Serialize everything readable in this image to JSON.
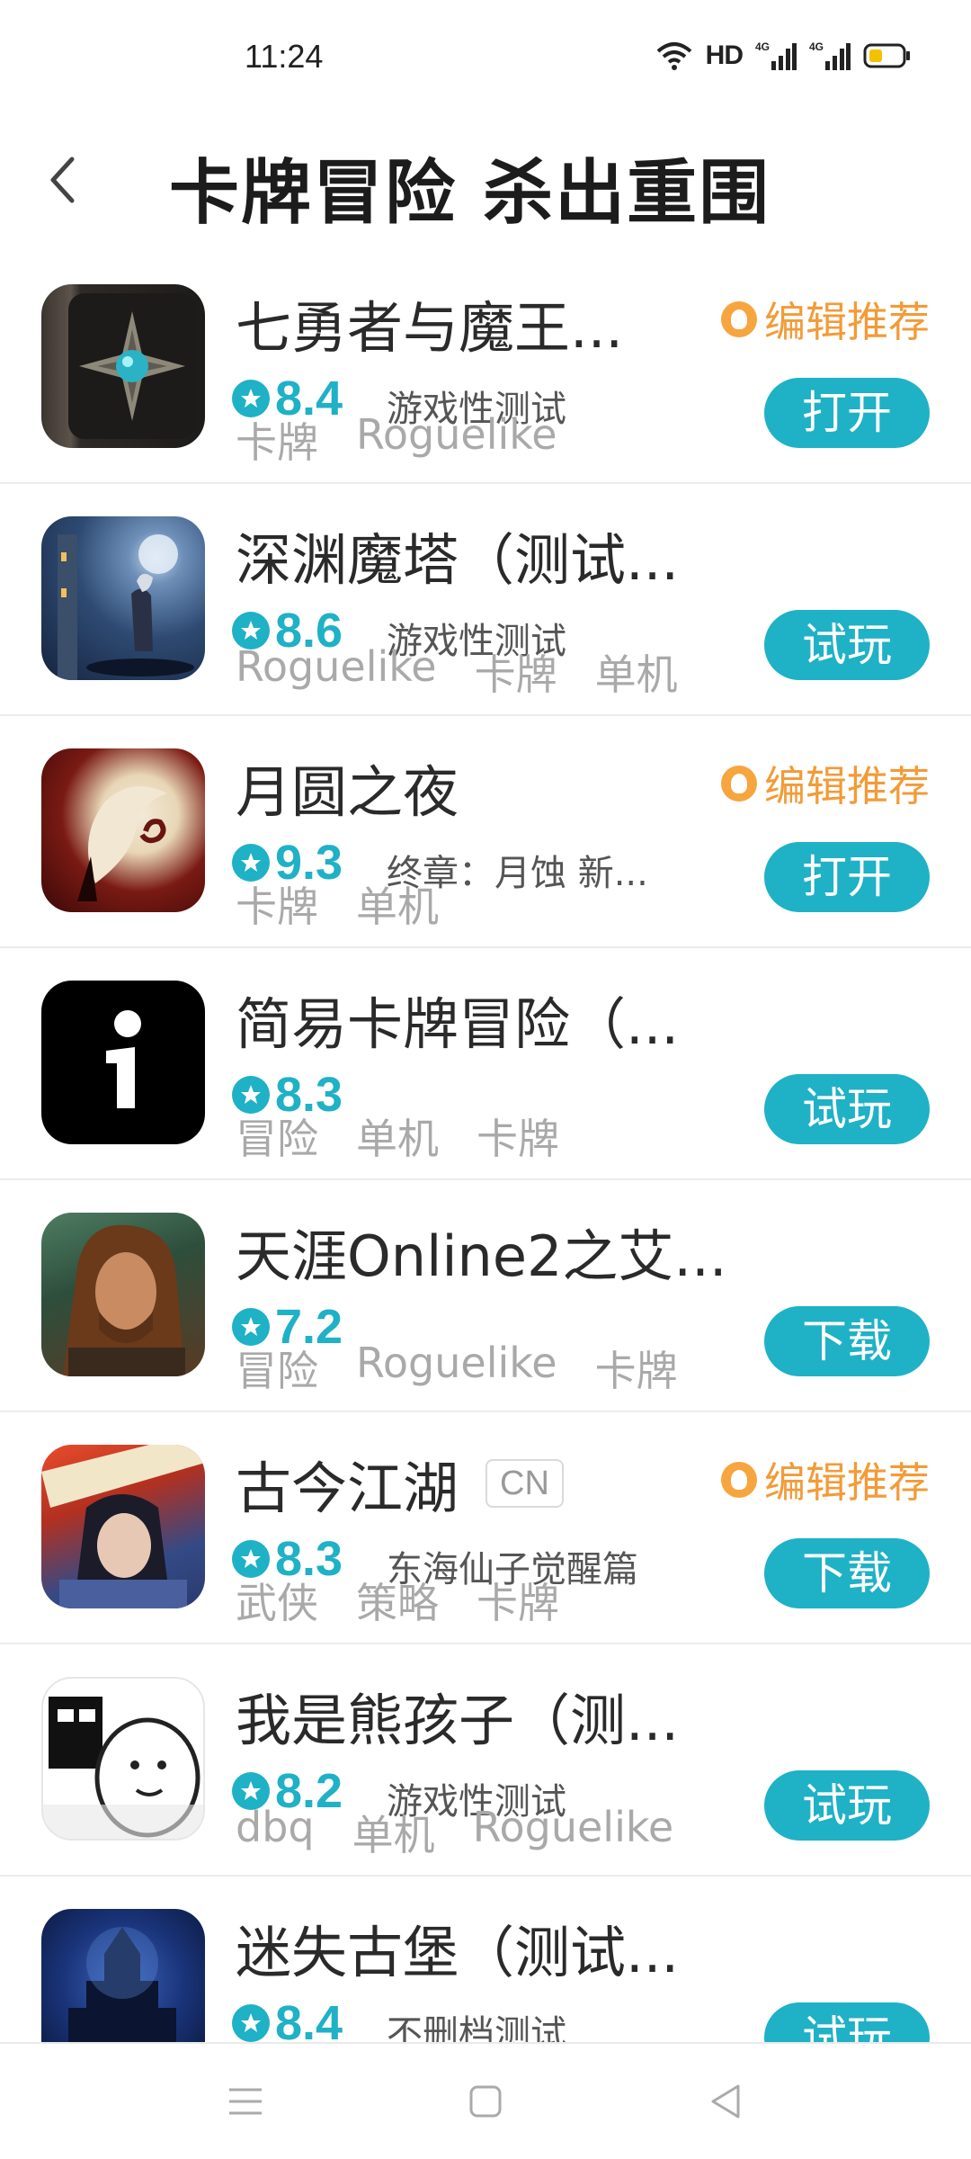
{
  "status_bar": {
    "time": "11:24",
    "network_label": "HD",
    "signal_1": "4G",
    "signal_2": "4G",
    "battery_icon": "battery-low-icon"
  },
  "header": {
    "back_icon": "chevron-left-icon",
    "title": "卡牌冒险 杀出重围"
  },
  "colors": {
    "accent": "#1fb1c6",
    "editor_tag": "#f29b38",
    "tag_text": "#a9a9a9"
  },
  "apps": [
    {
      "name": "七勇者与魔王...",
      "rating": "8.4",
      "subtitle": "游戏性测试",
      "tags": [
        "卡牌",
        "Roguelike"
      ],
      "editor_pick": "编辑推荐",
      "action": "打开"
    },
    {
      "name": "深渊魔塔（测试...",
      "rating": "8.6",
      "subtitle": "游戏性测试",
      "tags": [
        "Roguelike",
        "卡牌",
        "单机"
      ],
      "action": "试玩"
    },
    {
      "name": "月圆之夜",
      "rating": "9.3",
      "subtitle": "终章：月蚀 新...",
      "tags": [
        "卡牌",
        "单机"
      ],
      "editor_pick": "编辑推荐",
      "action": "打开"
    },
    {
      "name": "简易卡牌冒险（...",
      "rating": "8.3",
      "subtitle": "",
      "tags": [
        "冒险",
        "单机",
        "卡牌"
      ],
      "action": "试玩"
    },
    {
      "name": "天涯Online2之艾...",
      "rating": "7.2",
      "subtitle": "",
      "tags": [
        "冒险",
        "Roguelike",
        "卡牌"
      ],
      "action": "下载"
    },
    {
      "name": "古今江湖",
      "badge": "CN",
      "rating": "8.3",
      "subtitle": "东海仙子觉醒篇",
      "tags": [
        "武侠",
        "策略",
        "卡牌"
      ],
      "editor_pick": "编辑推荐",
      "action": "下载"
    },
    {
      "name": "我是熊孩子（测...",
      "rating": "8.2",
      "subtitle": "游戏性测试",
      "tags": [
        "dbq",
        "单机",
        "Roguelike"
      ],
      "action": "试玩"
    },
    {
      "name": "迷失古堡（测试...",
      "rating": "8.4",
      "subtitle": "不删档测试",
      "tags": [],
      "action": "试玩"
    }
  ],
  "icons": {
    "app_1": "compass-book-icon",
    "app_2": "moonlit-tower-icon",
    "app_3": "crescent-moon-icon",
    "app_4": "letter-i-icon",
    "app_5": "warrior-portrait-icon",
    "app_6": "swordsman-portrait-icon",
    "app_7": "bear-meme-icon",
    "app_8": "castle-night-icon",
    "nav_menu": "menu-icon",
    "nav_home": "home-square-icon",
    "nav_back": "back-triangle-icon"
  }
}
